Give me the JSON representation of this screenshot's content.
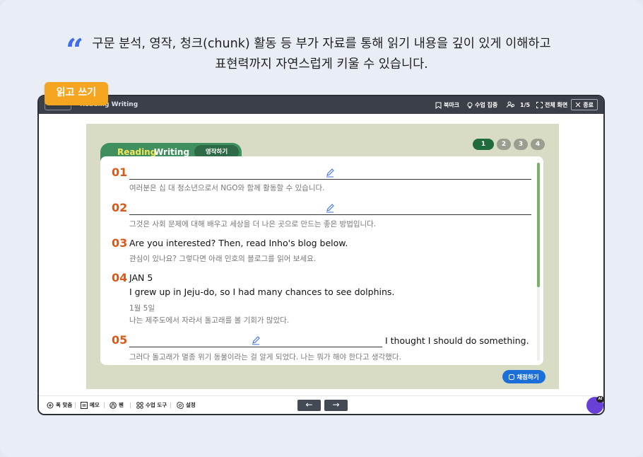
{
  "intro": {
    "quote_mark": "“",
    "line1": "구문 분석, 영작, 청크(chunk) 활동 등 부가 자료를 통해 읽기 내용을 깊이 있게 이해하고",
    "line2": "표현력까지 자연스럽게 키울 수 있습니다."
  },
  "badge": {
    "label": "읽고 쓰기"
  },
  "topbar": {
    "title": "Reading Writing",
    "bookmark": "북마크",
    "focus": "수업 집중",
    "page_count": "1/5",
    "fullscreen": "전체 화면",
    "exit": "종료"
  },
  "lesson": {
    "tab_reading": "Reading",
    "tab_writing": "Writing",
    "subtab": "영작하기",
    "pages": [
      "1",
      "2",
      "3",
      "4"
    ],
    "active_page": "1",
    "items": [
      {
        "num": "01",
        "en": "",
        "ko": "여러분은 십 대 청소년으로서 NGO와 함께 활동할 수 있습니다."
      },
      {
        "num": "02",
        "en": "",
        "ko": "그것은 사회 문제에 대해 배우고 세상을 더 나은 곳으로 만드는 좋은 방법입니다."
      },
      {
        "num": "03",
        "en": "Are you interested? Then, read Inho's blog below.",
        "ko": "관심이 있나요? 그렇다면 아래 인호의 블로그를 읽어 보세요."
      },
      {
        "num": "04",
        "en_date": "JAN 5",
        "en": "I grew up in Jeju-do, so I had many chances to see dolphins.",
        "ko_date": "1월 5일",
        "ko": "나는 제주도에서 자라서 돌고래를 볼 기회가 많았다."
      },
      {
        "num": "05",
        "en": "I thought I should do something.",
        "ko": "그러다 돌고래가 멸종 위기 동물이라는 걸 알게 되었다. 나는 뭐가 해야 한다고 생각했다."
      }
    ],
    "grade_button": "채점하기"
  },
  "bottombar": {
    "hint": "폭 맞춤",
    "memo": "메모",
    "pen": "펜",
    "tools": "수업 도구",
    "settings": "설정",
    "prev": "←",
    "next": "→",
    "ai_badge": "AI"
  },
  "colors": {
    "accent_orange": "#d9591a",
    "green": "#3f8f5f",
    "blue": "#1d6fd8",
    "badge": "#f5a51f"
  }
}
